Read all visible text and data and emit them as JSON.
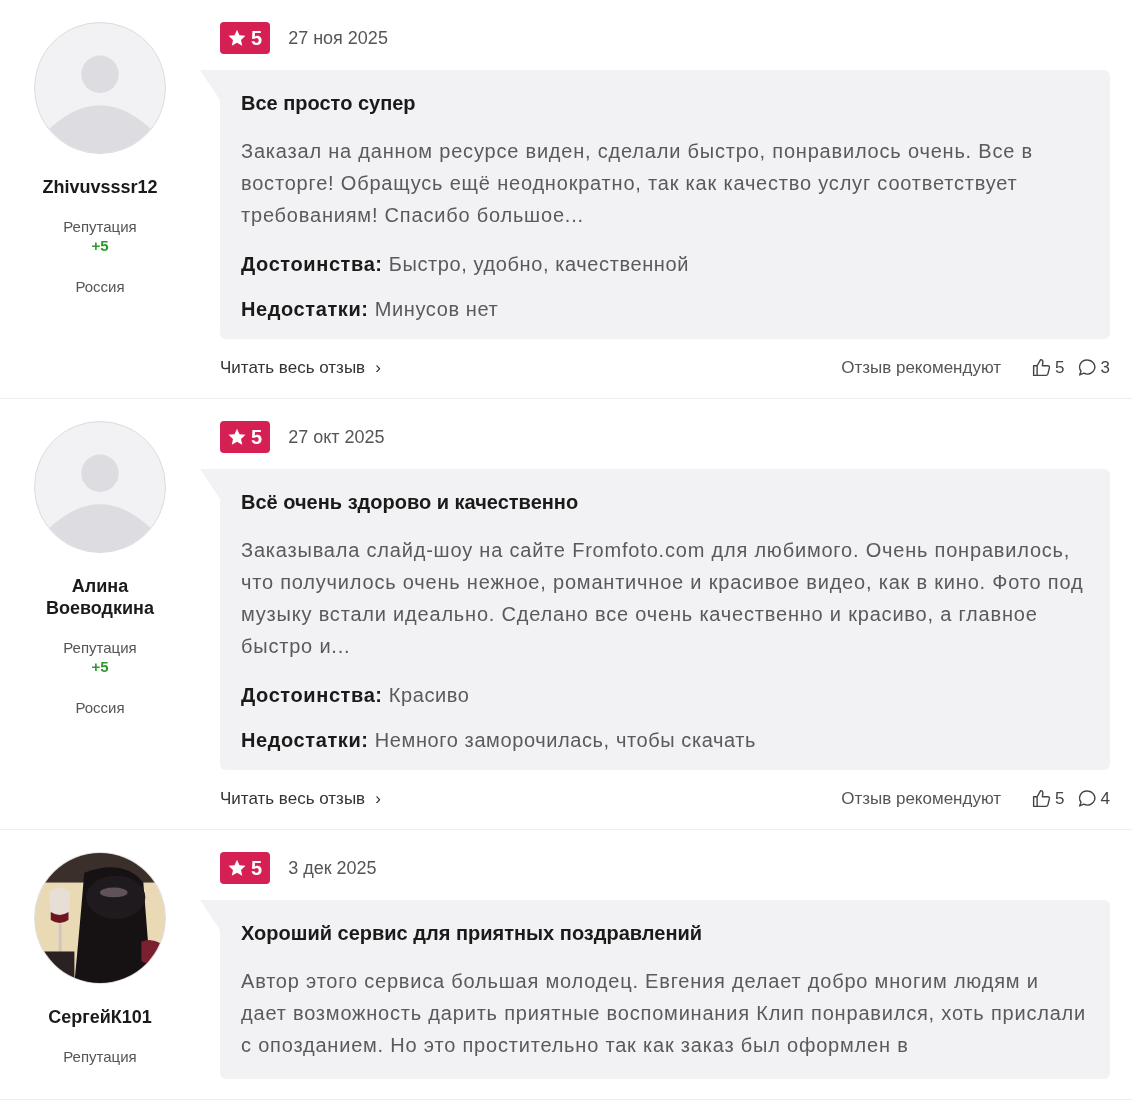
{
  "reviews": [
    {
      "author": {
        "name": "Zhivuvsssr12",
        "avatar": {
          "kind": "placeholder"
        },
        "reputation_label": "Репутация",
        "reputation": "+5",
        "country": "Россия"
      },
      "rating": "5",
      "date": "27 ноя 2025",
      "title": "Все просто супер",
      "text": "Заказал на данном ресурсе виден, сделали быстро, понравилось очень. Все в восторге! Обращусь ещё неоднократно, так как качество услуг соответствует требованиям! Спасибо большое...",
      "pros_label": "Достоинства:",
      "pros": "Быстро, удобно, качественной",
      "cons_label": "Недостатки:",
      "cons": "Минусов нет",
      "read_more": "Читать весь отзыв",
      "chevron": "›",
      "recommend_label": "Отзыв рекомендуют",
      "likes": "5",
      "comments": "3"
    },
    {
      "author": {
        "name": "Алина Воеводкина",
        "avatar": {
          "kind": "placeholder"
        },
        "reputation_label": "Репутация",
        "reputation": "+5",
        "country": "Россия"
      },
      "rating": "5",
      "date": "27 окт 2025",
      "title": "Всё очень здорово и качественно",
      "text": "Заказывала слайд-шоу на сайте Fromfoto.com для любимого. Очень понравилось, что получилось очень нежное, романтичное и красивое видео, как в кино. Фото под музыку встали идеально. Сделано все очень качественно и красиво, а главное быстро и...",
      "pros_label": "Достоинства:",
      "pros": "Красиво",
      "cons_label": "Недостатки:",
      "cons": "Немного заморочилась, чтобы скачать",
      "read_more": "Читать весь отзыв",
      "chevron": "›",
      "recommend_label": "Отзыв рекомендуют",
      "likes": "5",
      "comments": "4"
    },
    {
      "author": {
        "name": "СергейК101",
        "reputation_label": "Репутация"
      },
      "rating": "5",
      "date": "3 дек 2025",
      "title": "Хороший сервис для приятных поздравлений",
      "text": "Автор этого сервиса большая молодец. Евгения делает добро многим людям и дает возможность дарить приятные воспоминания Клип понравился, хоть прислали с опозданием. Но это простительно так как заказ был оформлен в"
    }
  ]
}
